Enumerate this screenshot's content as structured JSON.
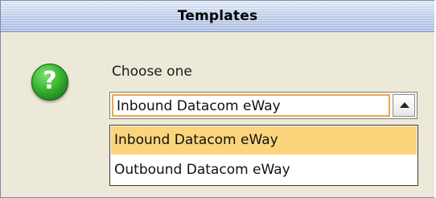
{
  "dialog": {
    "title": "Templates",
    "icon": "question-mark-icon",
    "icon_glyph": "?",
    "prompt": "Choose one"
  },
  "combo": {
    "selected_value": "Inbound Datacom eWay",
    "arrow_icon": "chevron-up-icon"
  },
  "dropdown": {
    "options": [
      {
        "label": "Inbound Datacom eWay",
        "highlighted": true
      },
      {
        "label": "Outbound Datacom eWay",
        "highlighted": false
      }
    ]
  },
  "colors": {
    "dialog_background": "#ece9d8",
    "highlight": "#fbd47c",
    "focus_border": "#e8a84c",
    "icon_green": "#39b532"
  }
}
